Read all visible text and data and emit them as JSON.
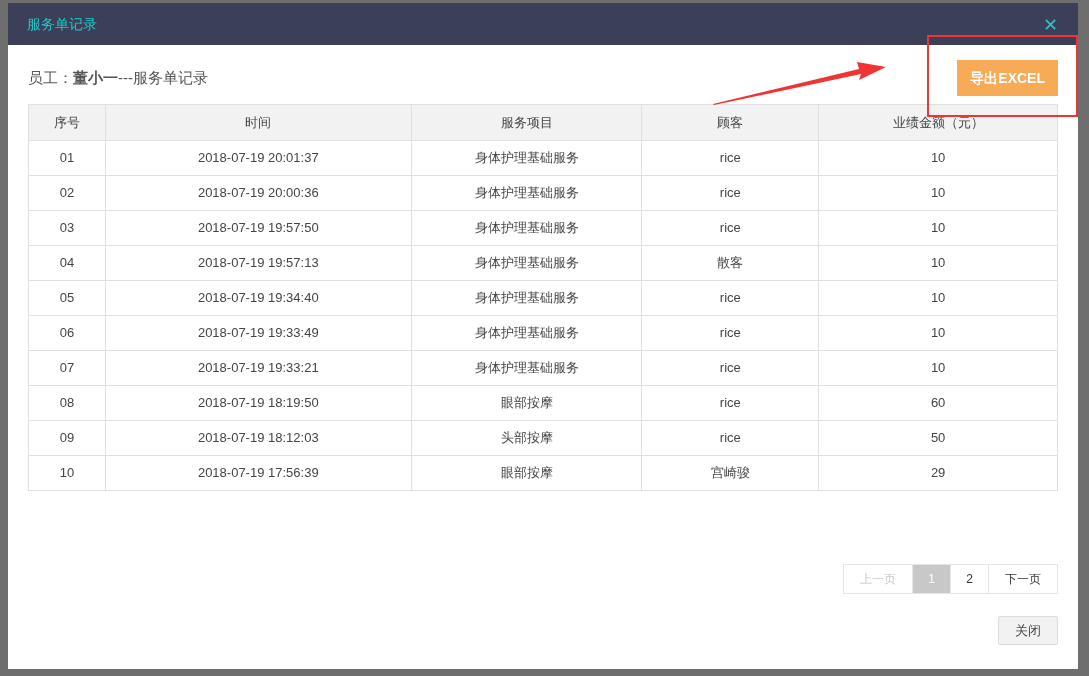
{
  "dialog": {
    "title": "服务单记录",
    "close_icon": "✕"
  },
  "subtitle": "员工：**董小一**---服务单记录",
  "export_button": "导出EXCEL",
  "table": {
    "columns": [
      "序号",
      "时间",
      "服务项目",
      "顾客",
      "业绩金额（元）"
    ],
    "rows": [
      [
        "01",
        "2018-07-19 20:01:37",
        "身体护理基础服务",
        "rice",
        "10"
      ],
      [
        "02",
        "2018-07-19 20:00:36",
        "身体护理基础服务",
        "rice",
        "10"
      ],
      [
        "03",
        "2018-07-19 19:57:50",
        "身体护理基础服务",
        "rice",
        "10"
      ],
      [
        "04",
        "2018-07-19 19:57:13",
        "身体护理基础服务",
        "散客",
        "10"
      ],
      [
        "05",
        "2018-07-19 19:34:40",
        "身体护理基础服务",
        "rice",
        "10"
      ],
      [
        "06",
        "2018-07-19 19:33:49",
        "身体护理基础服务",
        "rice",
        "10"
      ],
      [
        "07",
        "2018-07-19 19:33:21",
        "身体护理基础服务",
        "rice",
        "10"
      ],
      [
        "08",
        "2018-07-19 18:19:50",
        "眼部按摩",
        "rice",
        "60"
      ],
      [
        "09",
        "2018-07-19 18:12:03",
        "头部按摩",
        "rice",
        "50"
      ],
      [
        "10",
        "2018-07-19 17:56:39",
        "眼部按摩",
        "宫崎骏",
        "29"
      ]
    ]
  },
  "pagination": {
    "prev": {
      "label": "上一页",
      "disabled": true
    },
    "pages": [
      {
        "label": "1",
        "selected": true
      },
      {
        "label": "2",
        "selected": false
      }
    ],
    "next": {
      "label": "下一页",
      "disabled": false
    }
  },
  "close_button": "关闭"
}
